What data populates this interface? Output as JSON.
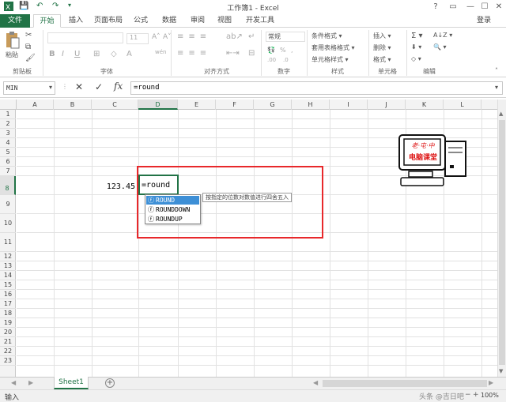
{
  "window": {
    "title": "工作簿1 - Excel",
    "help": "?",
    "min": "—",
    "max": "☐",
    "close": "✕"
  },
  "qat": {
    "save": "💾",
    "undo": "↶",
    "redo": "↷"
  },
  "tabs": [
    "文件",
    "开始",
    "插入",
    "页面布局",
    "公式",
    "数据",
    "审阅",
    "视图",
    "开发工具"
  ],
  "account": "登录",
  "ribbon": {
    "clipboard": {
      "label": "剪贴板",
      "paste": "粘贴"
    },
    "font": {
      "label": "字体",
      "size": "11",
      "bold": "B",
      "italic": "I",
      "underline": "U",
      "wen": "wén"
    },
    "align": {
      "label": "对齐方式"
    },
    "number": {
      "label": "数字",
      "format": "常规",
      "percent": "%",
      "comma": ",",
      "dec_inc": ".00",
      "dec_dec": ".0"
    },
    "styles": {
      "label": "样式",
      "cond": "条件格式 ▾",
      "table": "套用表格格式 ▾",
      "cell": "单元格样式 ▾"
    },
    "cells": {
      "label": "单元格",
      "insert": "插入 ▾",
      "delete": "删除 ▾",
      "format": "格式 ▾"
    },
    "edit": {
      "label": "编辑",
      "sigma": "Σ ▾",
      "sort": "A↓Z ▾",
      "find": "🔍 ▾"
    }
  },
  "formula_bar": {
    "name_box": "MIN",
    "cancel": "✕",
    "enter": "✓",
    "fx": "fx",
    "content": "=round"
  },
  "columns": [
    "A",
    "B",
    "C",
    "D",
    "E",
    "F",
    "G",
    "H",
    "I",
    "J",
    "K",
    "L"
  ],
  "rows": [
    "1",
    "2",
    "3",
    "4",
    "5",
    "6",
    "7",
    "8",
    "9",
    "10",
    "11",
    "12",
    "13",
    "14",
    "15",
    "16",
    "17",
    "18",
    "19",
    "20",
    "21",
    "22",
    "23"
  ],
  "cells": {
    "C8": "123.45",
    "D8": "=round"
  },
  "autocomplete": {
    "items": [
      "ROUND",
      "ROUNDDOWN",
      "ROUNDUP"
    ],
    "tooltip": "按指定的位数对数值进行四舍五入"
  },
  "logo": {
    "line1": "老·屯·中",
    "line2": "电脑课堂"
  },
  "sheet_tabs": [
    "Sheet1"
  ],
  "sheet_add": "+",
  "status": {
    "mode": "输入",
    "zoom": "100%",
    "watermark": "头条 @吉日吧",
    "zoom_minus": "−",
    "zoom_plus": "+"
  },
  "colors": {
    "excel_green": "#217346",
    "highlight_red": "#e8282b",
    "ac_selected": "#3d8fd6"
  }
}
